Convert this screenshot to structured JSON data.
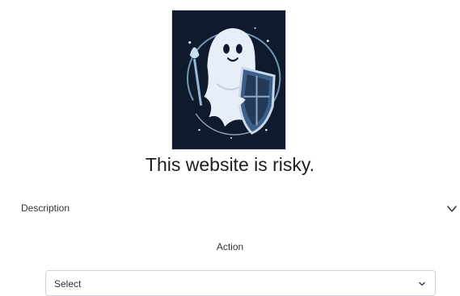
{
  "logo": {
    "icon": "ghost-with-shield-icon",
    "background_color": "#0f1a2c"
  },
  "page": {
    "title": "This website is risky."
  },
  "description": {
    "label": "Description",
    "expanded": false,
    "toggle_icon": "chevron-down-icon"
  },
  "action": {
    "label": "Action",
    "select": {
      "value": "Select",
      "icon": "chevron-down-icon"
    }
  }
}
